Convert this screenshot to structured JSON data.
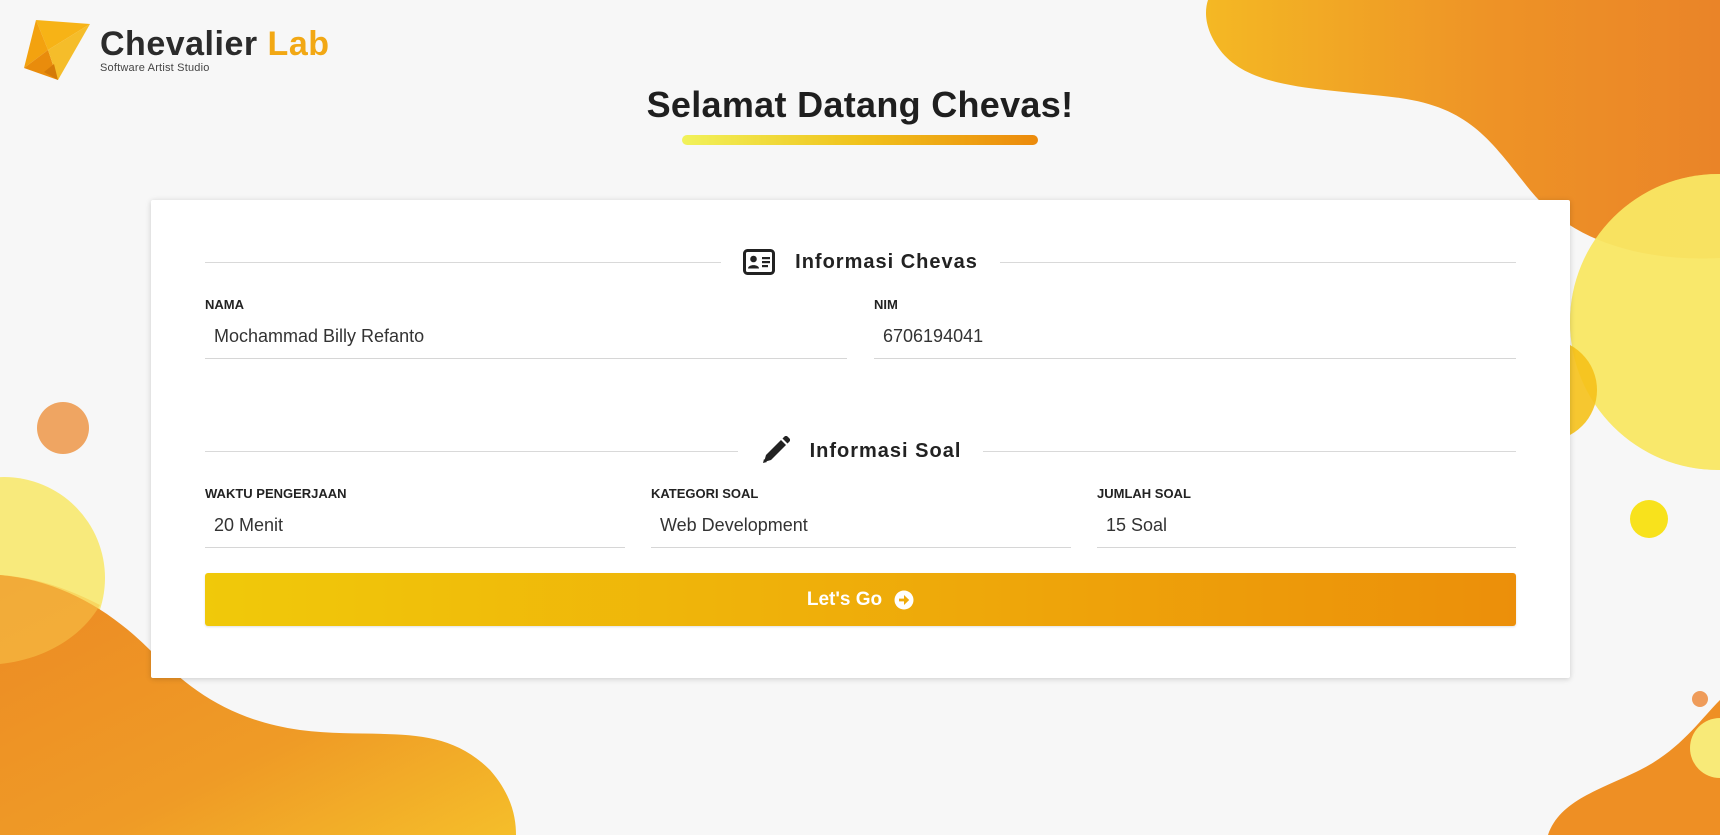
{
  "brand": {
    "name_part1": "Chevalier",
    "name_part2": "Lab",
    "tagline": "Software Artist Studio",
    "accent_color": "#f2a814"
  },
  "page": {
    "title": "Selamat Datang Chevas!"
  },
  "sections": {
    "chevas_info": {
      "title": "Informasi Chevas",
      "icon": "id-card-icon",
      "fields": {
        "nama": {
          "label": "NAMA",
          "value": "Mochammad Billy Refanto"
        },
        "nim": {
          "label": "NIM",
          "value": "6706194041"
        }
      }
    },
    "soal_info": {
      "title": "Informasi Soal",
      "icon": "pencil-icon",
      "fields": {
        "waktu": {
          "label": "WAKTU PENGERJAAN",
          "value": "20 Menit"
        },
        "kategori": {
          "label": "KATEGORI SOAL",
          "value": "Web Development"
        },
        "jumlah": {
          "label": "JUMLAH SOAL",
          "value": "15 Soal"
        }
      }
    }
  },
  "actions": {
    "go_label": "Let's Go",
    "go_icon": "arrow-circle-right-icon",
    "button_gradient": [
      "#f0c90a",
      "#ec8f0a"
    ]
  }
}
